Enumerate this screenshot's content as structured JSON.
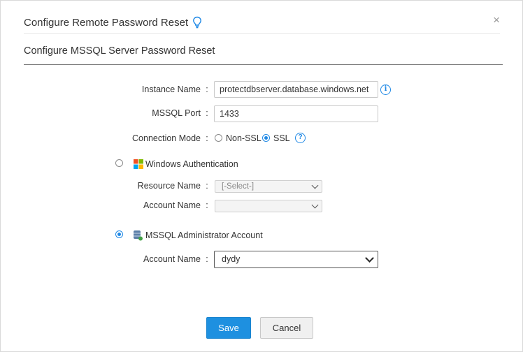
{
  "dialog": {
    "title": "Configure Remote Password Reset",
    "close_label": "×",
    "section_title": "Configure MSSQL Server Password Reset"
  },
  "form": {
    "instance_name": {
      "label": "Instance Name",
      "value": "protectdbserver.database.windows.net",
      "info_icon": "i"
    },
    "mssql_port": {
      "label": "MSSQL Port",
      "value": "1433"
    },
    "connection_mode": {
      "label": "Connection Mode",
      "options": [
        {
          "label": "Non-SSL",
          "selected": false
        },
        {
          "label": "SSL",
          "selected": true
        }
      ],
      "help_icon": "?"
    },
    "colon": ":"
  },
  "windows_auth": {
    "label": "Windows Authentication",
    "selected": false,
    "icon": "windows-icon",
    "resource_name": {
      "label": "Resource Name",
      "value": "[-Select-]"
    },
    "account_name": {
      "label": "Account Name",
      "value": ""
    }
  },
  "mssql_admin": {
    "label": "MSSQL Administrator Account",
    "selected": true,
    "icon": "database-icon",
    "account_name": {
      "label": "Account Name",
      "value": "dydy"
    }
  },
  "buttons": {
    "save": "Save",
    "cancel": "Cancel"
  },
  "colors": {
    "accent": "#1e90e0",
    "icon_blue": "#1e88e5"
  }
}
